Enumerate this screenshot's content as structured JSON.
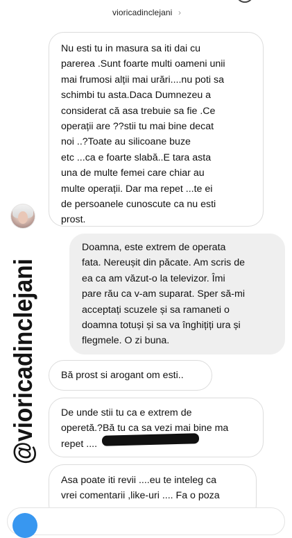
{
  "header": {
    "username": "viori​cadinclejani",
    "chevron": "›"
  },
  "watermark": {
    "text": "@viori​cadinclejani"
  },
  "messages": [
    {
      "side": "in",
      "lines": [
        "Nu esti tu in masura sa iti dai cu",
        "parerea .Sunt foarte multi oameni unii",
        "mai frumosi alții mai urări....nu poti sa",
        "schimbi tu asta.Daca Dumnezeu a",
        "considerat că asa trebuie sa fie .Ce",
        "operații are ??stii tu mai bine decat",
        "noi ..?Toate au silicoane buze",
        "etc ...ca e foarte slabă..E tara asta",
        "una de multe femei care chiar au",
        "multe operații. Dar ma repet ...te ei",
        "de persoanele cunoscute ca nu esti",
        "prost."
      ]
    },
    {
      "side": "out",
      "lines": [
        "Doamna, este extrem de operata",
        "fata. Nereușit din păcate. Am scris de",
        "ea ca am văzut-o la televizor. Îmi",
        "pare rău ca v-am suparat. Sper să-mi",
        "acceptați scuzele și sa ramaneti o",
        "doamna totuși și sa va înghițiți ura și",
        "flegmele. O zi buna."
      ]
    },
    {
      "side": "in",
      "lines": [
        "Bă prost si arogant om esti.."
      ]
    },
    {
      "side": "in",
      "lines": [
        "De unde stii tu ca e extrem de",
        "operetă.?Bă tu ca sa vezi mai bine ma",
        "repet ...."
      ]
    },
    {
      "side": "in",
      "lines": [
        "Asa poate iti revii ....eu te inteleg ca",
        "vrei comentarii ,like-uri .... Fa o poza"
      ]
    }
  ],
  "colors": {
    "incoming_bubble_border": "#dcdcdc",
    "outgoing_bubble_bg": "#efefef",
    "watermark": "#141414",
    "camera_button": "#3897f0"
  }
}
